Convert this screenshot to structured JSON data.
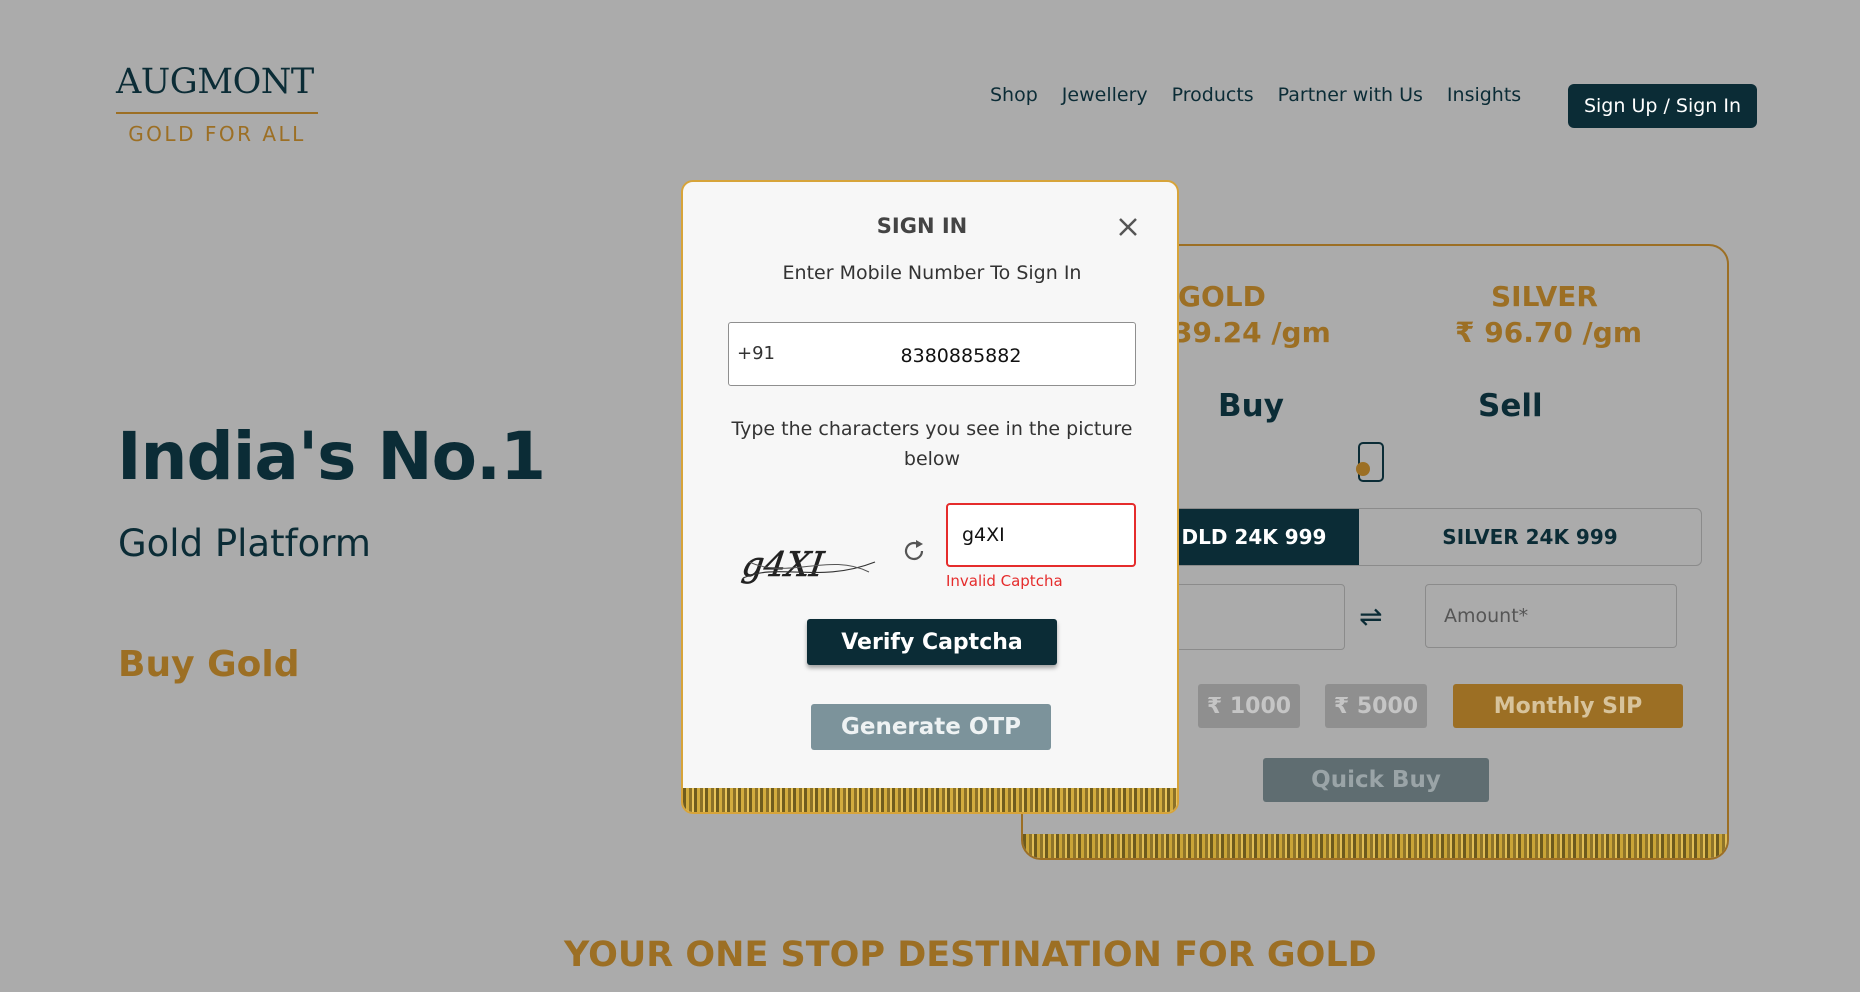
{
  "brand": {
    "name": "AUGMONT",
    "tagline": "GOLD FOR ALL"
  },
  "nav": {
    "items": [
      {
        "label": "Shop"
      },
      {
        "label": "Jewellery"
      },
      {
        "label": "Products"
      },
      {
        "label": "Partner with Us"
      },
      {
        "label": "Insights"
      }
    ],
    "auth_label": "Sign Up / Sign In"
  },
  "hero": {
    "title": "India's No.1",
    "subtitle": "Gold Platform",
    "cta": "Buy Gold"
  },
  "buy_card": {
    "gold_label": "GOLD",
    "gold_price": "39.24 /gm",
    "silver_label": "SILVER",
    "silver_price": "₹ 96.70 /gm",
    "buy_tab": "Buy",
    "sell_tab": "Sell",
    "metal_active": "DLD 24K 999",
    "metal_inactive": "SILVER 24K 999",
    "amount_placeholder": "Amount*",
    "preset_1": "₹ 1000",
    "preset_2": "₹ 5000",
    "sip_label": "Monthly SIP",
    "quick_buy_label": "Quick Buy"
  },
  "modal": {
    "title": "SIGN IN",
    "subtitle": "Enter Mobile Number To Sign In",
    "country_code": "+91",
    "phone_value": "8380885882",
    "captcha_instruction": "Type the characters you see in the picture below",
    "captcha_image_text": "g4XI",
    "captcha_value": "g4XI",
    "captcha_error": "Invalid Captcha",
    "verify_label": "Verify Captcha",
    "otp_label": "Generate OTP"
  },
  "section": {
    "heading": "YOUR ONE STOP DESTINATION FOR GOLD"
  },
  "colors": {
    "navy": "#0b2c36",
    "gold": "#9c6f24",
    "error": "#e52c2c",
    "overlay": "#ababab"
  }
}
